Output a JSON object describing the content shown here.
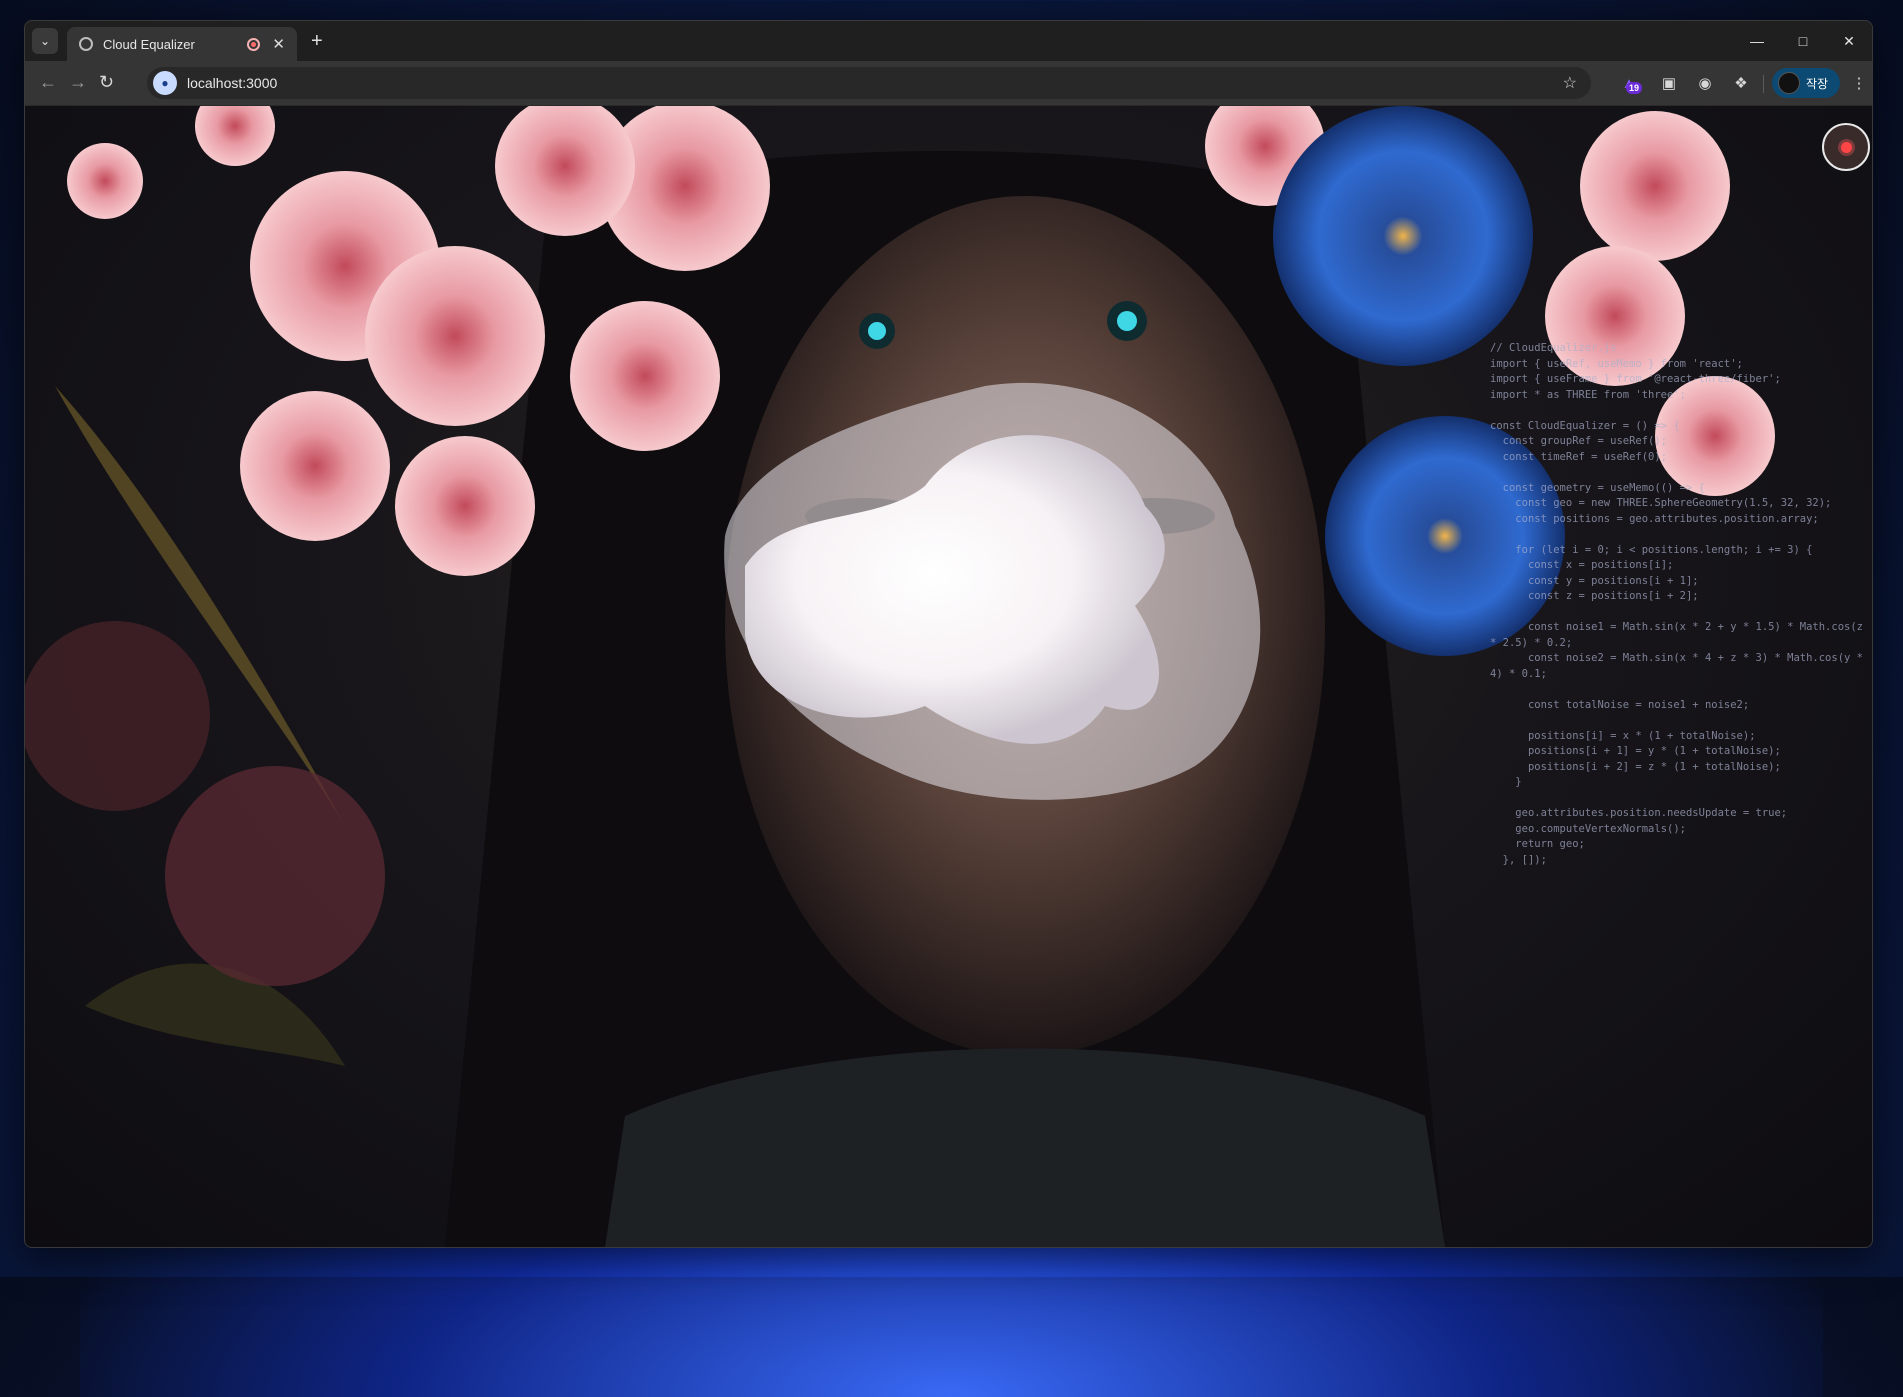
{
  "browser": {
    "tab_title": "Cloud Equalizer",
    "url": "localhost:3000",
    "extension_badge": "19",
    "profile_label": "작장"
  },
  "page": {
    "code_lines": [
      "// CloudEqualizer.js",
      "import { useRef, useMemo } from 'react';",
      "import { useFrame } from '@react-three/fiber';",
      "import * as THREE from 'three';",
      "",
      "const CloudEqualizer = () => {",
      "  const groupRef = useRef();",
      "  const timeRef = useRef(0);",
      "",
      "  const geometry = useMemo(() => {",
      "    const geo = new THREE.SphereGeometry(1.5, 32, 32);",
      "    const positions = geo.attributes.position.array;",
      "",
      "    for (let i = 0; i < positions.length; i += 3) {",
      "      const x = positions[i];",
      "      const y = positions[i + 1];",
      "      const z = positions[i + 2];",
      "",
      "      const noise1 = Math.sin(x * 2 + y * 1.5) * Math.cos(z * 2.5) * 0.2;",
      "      const noise2 = Math.sin(x * 4 + z * 3) * Math.cos(y * 4) * 0.1;",
      "",
      "      const totalNoise = noise1 + noise2;",
      "",
      "      positions[i] = x * (1 + totalNoise);",
      "      positions[i + 1] = y * (1 + totalNoise);",
      "      positions[i + 2] = z * (1 + totalNoise);",
      "    }",
      "",
      "    geo.attributes.position.needsUpdate = true;",
      "    geo.computeVertexNormals();",
      "    return geo;",
      "  }, []);"
    ]
  }
}
